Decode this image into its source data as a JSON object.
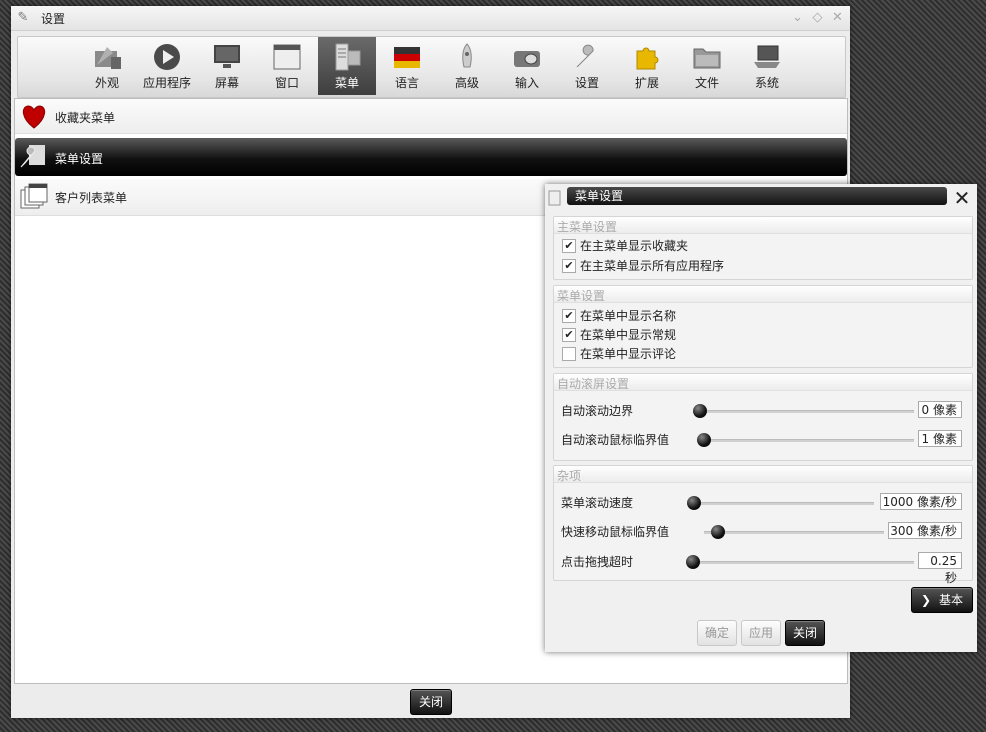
{
  "window": {
    "title": "设置"
  },
  "toolbar": {
    "items": [
      {
        "label": "外观",
        "icon": "appearance-icon"
      },
      {
        "label": "应用程序",
        "icon": "play-icon"
      },
      {
        "label": "屏幕",
        "icon": "monitor-icon"
      },
      {
        "label": "窗口",
        "icon": "window-icon"
      },
      {
        "label": "菜单",
        "icon": "menu-icon",
        "active": true
      },
      {
        "label": "语言",
        "icon": "flag-icon"
      },
      {
        "label": "高级",
        "icon": "rocket-icon"
      },
      {
        "label": "输入",
        "icon": "mouse-icon"
      },
      {
        "label": "设置",
        "icon": "wrench-icon"
      },
      {
        "label": "扩展",
        "icon": "puzzle-icon"
      },
      {
        "label": "文件",
        "icon": "folder-icon"
      },
      {
        "label": "系统",
        "icon": "laptop-icon"
      }
    ]
  },
  "list": {
    "items": [
      {
        "label": "收藏夹菜单",
        "icon": "heart-icon"
      },
      {
        "label": "菜单设置",
        "icon": "menu-settings-icon",
        "selected": true
      },
      {
        "label": "客户列表菜单",
        "icon": "windows-list-icon"
      }
    ]
  },
  "bottom": {
    "close_label": "关闭"
  },
  "dialog": {
    "title": "菜单设置",
    "groups": {
      "main_menu": {
        "title": "主菜单设置",
        "options": [
          {
            "label": "在主菜单显示收藏夹",
            "checked": true
          },
          {
            "label": "在主菜单显示所有应用程序",
            "checked": true
          }
        ]
      },
      "menu": {
        "title": "菜单设置",
        "options": [
          {
            "label": "在菜单中显示名称",
            "checked": true
          },
          {
            "label": "在菜单中显示常规",
            "checked": true
          },
          {
            "label": "在菜单中显示评论",
            "checked": false
          }
        ]
      },
      "autoscroll": {
        "title": "自动滚屏设置",
        "rows": [
          {
            "label": "自动滚动边界",
            "value": "0 像素"
          },
          {
            "label": "自动滚动鼠标临界值",
            "value": "1 像素"
          }
        ]
      },
      "misc": {
        "title": "杂项",
        "rows": [
          {
            "label": "菜单滚动速度",
            "value": "1000 像素/秒"
          },
          {
            "label": "快速移动鼠标临界值",
            "value": "300 像素/秒"
          },
          {
            "label": "点击拖拽超时",
            "value": "0.25 秒"
          }
        ]
      }
    },
    "basic_label": "基本",
    "buttons": {
      "ok": "确定",
      "apply": "应用",
      "close": "关闭"
    }
  },
  "colors": {
    "selection": "#111111",
    "accent_heart": "#c00000"
  }
}
